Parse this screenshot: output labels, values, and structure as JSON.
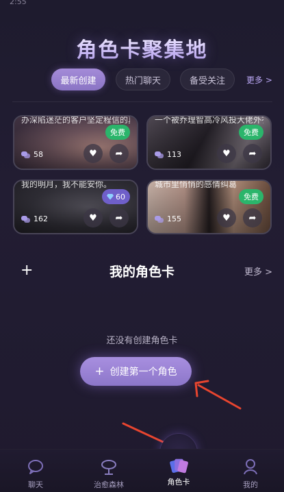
{
  "status_bar": {
    "time": "2:55"
  },
  "header": {
    "title": "角色卡聚集地"
  },
  "tabs": [
    {
      "label": "最新创建",
      "active": true
    },
    {
      "label": "热门聊天",
      "active": false
    },
    {
      "label": "备受关注",
      "active": false
    }
  ],
  "tabs_more": "更多 >",
  "cards": [
    {
      "text": "办深陷迷茫的客户坚定程信的真心与边界，探索爱",
      "badge": "免费",
      "chats": "58",
      "theme": "warm-blur"
    },
    {
      "text": "一个被乔理智高冷风投大佬外衣，实则将深情藏在",
      "badge": "免费",
      "chats": "113",
      "theme": "dark-suit"
    },
    {
      "text": "我的明月，我不能安你。",
      "badge": "60",
      "badge_type": "gem",
      "chats": "162",
      "theme": "smoky"
    },
    {
      "text": "城市里悄悄的感情纠葛",
      "badge": "免费",
      "chats": "155",
      "theme": "faces"
    }
  ],
  "my_cards": {
    "plus": "+",
    "title": "我的角色卡",
    "more": "更多 >"
  },
  "empty": {
    "text": "还没有创建角色卡",
    "button_label": "创建第一个角色",
    "button_plus": "+"
  },
  "bottom_nav": [
    {
      "label": "聊天",
      "icon": "chat-bubble-icon",
      "active": false
    },
    {
      "label": "治愈森林",
      "icon": "tree-icon",
      "active": false
    },
    {
      "label": "角色卡",
      "icon": "cards-icon",
      "active": true
    },
    {
      "label": "我的",
      "icon": "profile-icon",
      "active": false
    }
  ],
  "colors": {
    "accent": "#9a82d6",
    "free_badge": "#2bb56b",
    "gem_badge": "#6f5fc9",
    "arrow": "#e8452f"
  }
}
